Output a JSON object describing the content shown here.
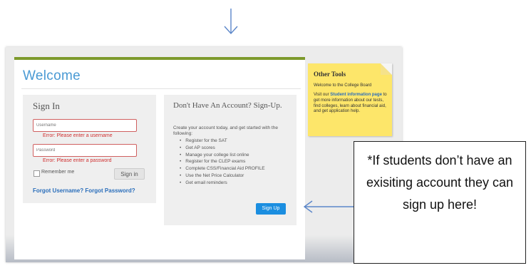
{
  "welcome": {
    "title": "Welcome"
  },
  "signin": {
    "title": "Sign In",
    "username_placeholder": "Username",
    "username_error": "Error: Please enter a username",
    "password_placeholder": "Password",
    "password_error": "Error: Please enter a password",
    "remember_label": "Remember me",
    "signin_button": "Sign in",
    "forgot_username": "Forgot Username?",
    "forgot_password": "Forgot Password?"
  },
  "signup": {
    "title": "Don't Have An Account? Sign-Up.",
    "intro": "Create your account today, and get started with the following:",
    "items": [
      "Register for the SAT",
      "Get AP scores",
      "Manage your college list online",
      "Register for the CLEP exams",
      "Complete CSS/Financial Aid PROFILE",
      "Use the Net Price Calculator",
      "Get email reminders"
    ],
    "button": "Sign Up"
  },
  "tools": {
    "title": "Other Tools",
    "welcome": "Welcome to the College Board",
    "desc_prefix": "Visit our ",
    "desc_link": "Student information page",
    "desc_suffix": " to get more information about our tests, find colleges, learn about financial aid, and get application help."
  },
  "callout": {
    "text": "*If students don’t have an exisiting account they can sign up here!"
  },
  "colors": {
    "accent_green": "#7d9a2c",
    "welcome_blue": "#4a9ad4",
    "signup_button": "#1b8ee0",
    "error_red": "#d03030",
    "sticky_yellow": "#fde66a"
  },
  "icons": [
    "down-arrow-icon",
    "left-arrow-icon",
    "checkbox-icon"
  ]
}
